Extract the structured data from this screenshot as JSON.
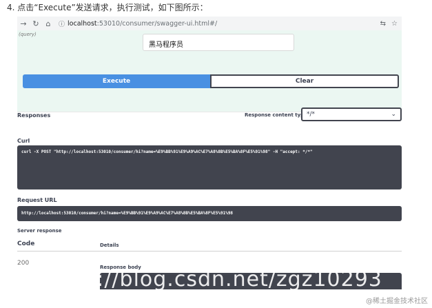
{
  "step_text": "4. 点击“Execute”发送请求，执行测试，如下图所示：",
  "browser": {
    "url_host": "localhost",
    "url_path": ":53010/consumer/swagger-ui.html#/"
  },
  "params": {
    "query_label": "(query)",
    "name_value": "黑马程序员"
  },
  "buttons": {
    "execute": "Execute",
    "clear": "Clear"
  },
  "responses": {
    "title": "Responses",
    "content_type_label": "Response content type",
    "content_type_value": "*/*"
  },
  "curl": {
    "label": "Curl",
    "command": "curl -X POST \"http://localhost:53010/consumer/hi?name=%E9%BB%91%E9%A9%AC%E7%A8%8B%E5%BA%8F%E5%91%98\" -H \"accept: */*\""
  },
  "request_url": {
    "label": "Request URL",
    "value": "http://localhost:53010/consumer/hi?name=%E9%BB%91%E9%A9%AC%E7%A8%8B%E5%BA%8F%E5%91%98"
  },
  "server_response": {
    "label": "Server response",
    "code_header": "Code",
    "details_header": "Details",
    "code": "200",
    "body_label": "Response body"
  },
  "watermark": "https://blog.csdn.net/zgz10293",
  "credit": "@稀土掘金技术社区"
}
